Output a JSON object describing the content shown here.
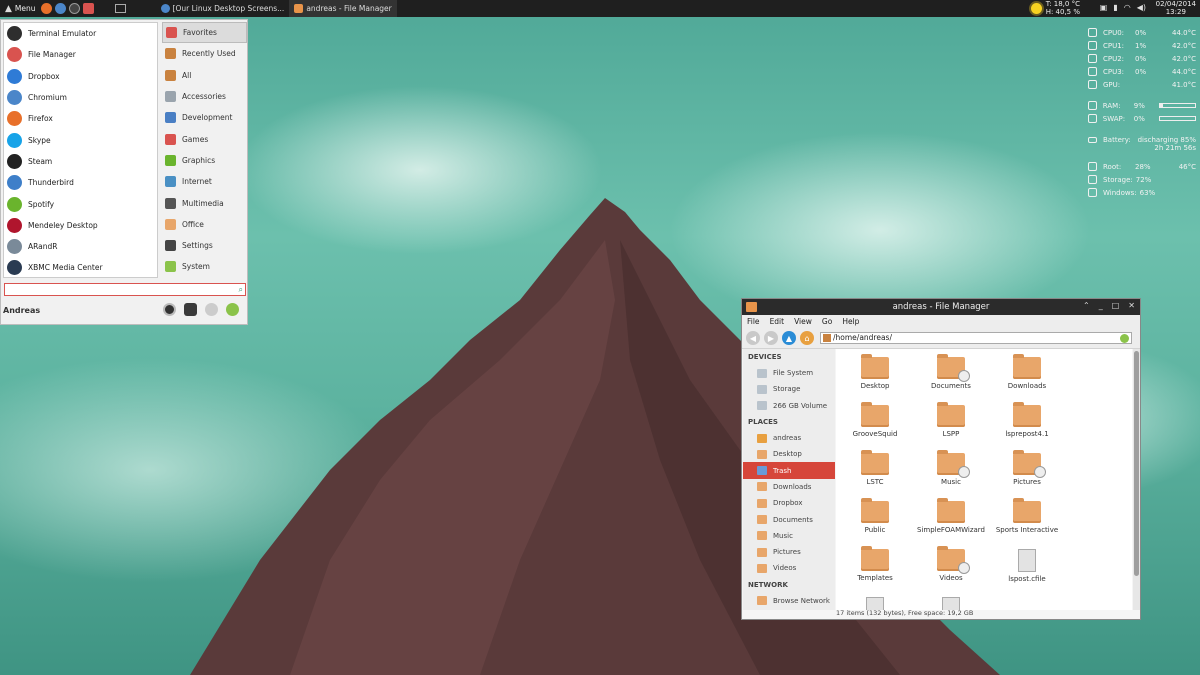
{
  "top_panel": {
    "menu_label": "Menu",
    "tasks": [
      {
        "label": "[Our Linux Desktop Screens...",
        "icon": "chrome-icon"
      },
      {
        "label": "andreas - File Manager",
        "icon": "folder-icon"
      }
    ],
    "weather": {
      "temp": "T: 18,0 °C",
      "humidity": "H: 40,5 %"
    },
    "clock": {
      "date": "02/04/2014",
      "time": "13:29"
    }
  },
  "conky": {
    "cpus": [
      {
        "label": "CPU0:",
        "usage": "0%",
        "temp": "44.0°C"
      },
      {
        "label": "CPU1:",
        "usage": "1%",
        "temp": "42.0°C"
      },
      {
        "label": "CPU2:",
        "usage": "0%",
        "temp": "42.0°C"
      },
      {
        "label": "CPU3:",
        "usage": "0%",
        "temp": "44.0°C"
      },
      {
        "label": "GPU:",
        "usage": "",
        "temp": "41.0°C"
      }
    ],
    "ram": {
      "label": "RAM:",
      "value": "9%",
      "fill": 0.09
    },
    "swap": {
      "label": "SWAP:",
      "value": "0%",
      "fill": 0.0
    },
    "battery": {
      "label": "Battery:",
      "status": "discharging 85%",
      "remaining": "2h 21m 56s"
    },
    "disks": [
      {
        "label": "Root:",
        "value": "28%",
        "extra": "46°C"
      },
      {
        "label": "Storage:",
        "value": "72%",
        "extra": ""
      },
      {
        "label": "Windows:",
        "value": "63%",
        "extra": ""
      }
    ]
  },
  "menu": {
    "apps": [
      {
        "label": "Terminal Emulator",
        "icon": "terminal-icon",
        "color": "#2e2e2e"
      },
      {
        "label": "File Manager",
        "icon": "file-manager-icon",
        "color": "#d9534f"
      },
      {
        "label": "Dropbox",
        "icon": "dropbox-icon",
        "color": "#2f7bd6"
      },
      {
        "label": "Chromium",
        "icon": "chromium-icon",
        "color": "#4b86c9"
      },
      {
        "label": "Firefox",
        "icon": "firefox-icon",
        "color": "#e8702a"
      },
      {
        "label": "Skype",
        "icon": "skype-icon",
        "color": "#17a3e8"
      },
      {
        "label": "Steam",
        "icon": "steam-icon",
        "color": "#222222"
      },
      {
        "label": "Thunderbird",
        "icon": "thunderbird-icon",
        "color": "#3e7fc9"
      },
      {
        "label": "Spotify",
        "icon": "spotify-icon",
        "color": "#6ab42d"
      },
      {
        "label": "Mendeley Desktop",
        "icon": "mendeley-icon",
        "color": "#b0152d"
      },
      {
        "label": "ARandR",
        "icon": "arandr-icon",
        "color": "#7a8a99"
      },
      {
        "label": "XBMC Media Center",
        "icon": "xbmc-icon",
        "color": "#2a3b52"
      }
    ],
    "categories": [
      {
        "label": "Favorites",
        "icon": "bookmark-icon",
        "color": "#d9534f"
      },
      {
        "label": "Recently Used",
        "icon": "recent-icon",
        "color": "#c9823f"
      },
      {
        "label": "All",
        "icon": "all-icon",
        "color": "#c9823f"
      },
      {
        "label": "Accessories",
        "icon": "accessories-icon",
        "color": "#9aa4ad"
      },
      {
        "label": "Development",
        "icon": "development-icon",
        "color": "#4a7fc4"
      },
      {
        "label": "Games",
        "icon": "games-icon",
        "color": "#d9534f"
      },
      {
        "label": "Graphics",
        "icon": "graphics-icon",
        "color": "#6ab42d"
      },
      {
        "label": "Internet",
        "icon": "internet-icon",
        "color": "#4a90c4"
      },
      {
        "label": "Multimedia",
        "icon": "multimedia-icon",
        "color": "#555555"
      },
      {
        "label": "Office",
        "icon": "office-icon",
        "color": "#e8a66a"
      },
      {
        "label": "Settings",
        "icon": "settings-icon",
        "color": "#444444"
      },
      {
        "label": "System",
        "icon": "system-icon",
        "color": "#8bc34a"
      }
    ],
    "search_value": "",
    "user": "Andreas"
  },
  "file_manager": {
    "title": "andreas - File Manager",
    "menubar": [
      "File",
      "Edit",
      "View",
      "Go",
      "Help"
    ],
    "path": "/home/andreas/",
    "sidebar": {
      "devices_header": "DEVICES",
      "devices": [
        "File System",
        "Storage",
        "266 GB Volume"
      ],
      "places_header": "PLACES",
      "places": [
        "andreas",
        "Desktop",
        "Trash",
        "Downloads",
        "Dropbox",
        "Documents",
        "Music",
        "Pictures",
        "Videos"
      ],
      "network_header": "NETWORK",
      "network": [
        "Browse Network"
      ]
    },
    "files": [
      {
        "name": "Desktop",
        "type": "folder",
        "badge": false
      },
      {
        "name": "Documents",
        "type": "folder",
        "badge": true
      },
      {
        "name": "Downloads",
        "type": "folder",
        "badge": false
      },
      {
        "name": "GrooveSquid",
        "type": "folder",
        "badge": false
      },
      {
        "name": "LSPP",
        "type": "folder",
        "badge": false
      },
      {
        "name": "lsprepost4.1",
        "type": "folder",
        "badge": false
      },
      {
        "name": "LSTC",
        "type": "folder",
        "badge": false
      },
      {
        "name": "Music",
        "type": "folder",
        "badge": true
      },
      {
        "name": "Pictures",
        "type": "folder",
        "badge": true
      },
      {
        "name": "Public",
        "type": "folder",
        "badge": false
      },
      {
        "name": "SimpleFOAMWizard",
        "type": "folder",
        "badge": false
      },
      {
        "name": "Sports Interactive",
        "type": "folder",
        "badge": false
      },
      {
        "name": "Templates",
        "type": "folder",
        "badge": false
      },
      {
        "name": "Videos",
        "type": "folder",
        "badge": true
      },
      {
        "name": "lspost.cfile",
        "type": "file",
        "badge": false
      }
    ],
    "status": "17 items (132 bytes), Free space: 19,2 GB"
  }
}
